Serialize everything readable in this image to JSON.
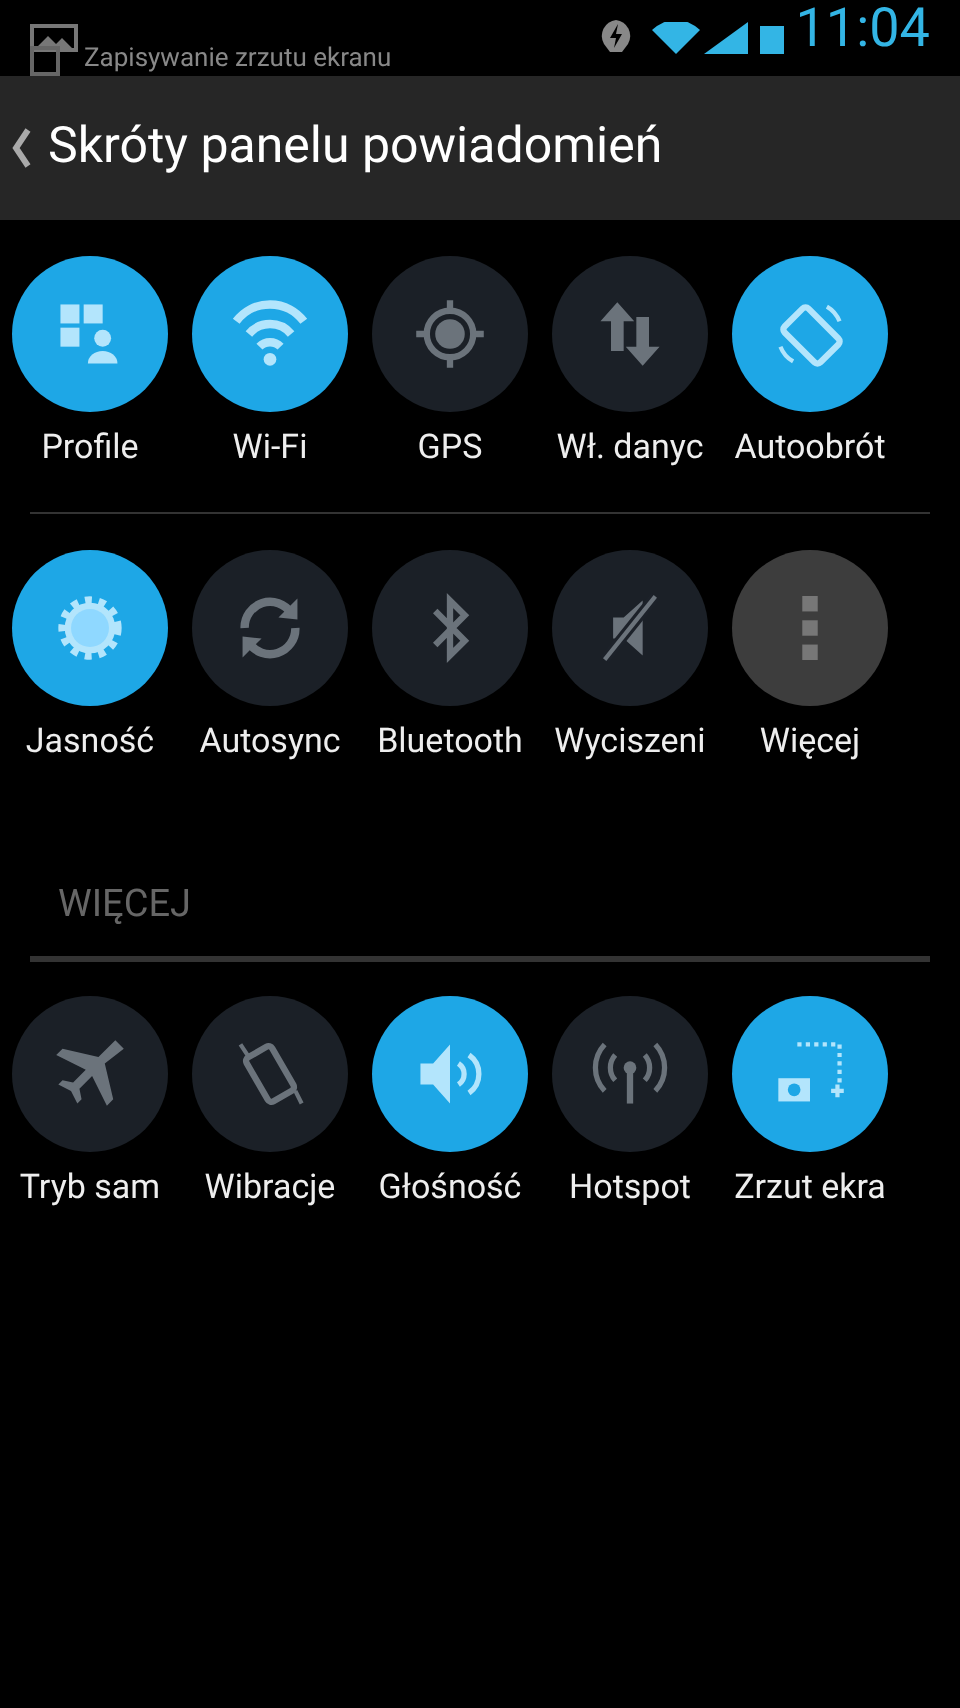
{
  "status_bar": {
    "time": "11:04"
  },
  "notification": {
    "checked": false,
    "title": "Zapisywanie zrzutu ekranu"
  },
  "header": {
    "title": "Skróty panelu powiadomień"
  },
  "groups": [
    {
      "tiles": [
        {
          "label": "Profile",
          "kind": "toggle",
          "on": true
        },
        {
          "label": "Wi-Fi",
          "kind": "toggle",
          "on": true
        },
        {
          "label": "GPS",
          "kind": "toggle",
          "on": false
        },
        {
          "label": "Wł. danyc",
          "kind": "toggle",
          "on": false
        },
        {
          "label": "Autoobrót",
          "kind": "toggle",
          "on": true
        }
      ]
    },
    {
      "tiles": [
        {
          "label": "Jasność",
          "kind": "toggle",
          "on": true
        },
        {
          "label": "Autosync",
          "kind": "toggle",
          "on": false
        },
        {
          "label": "Bluetooth",
          "kind": "toggle",
          "on": false
        },
        {
          "label": "Wyciszeni",
          "kind": "toggle",
          "on": false
        },
        {
          "label": "Więcej",
          "kind": "more"
        }
      ]
    },
    {
      "title": "WIĘCEJ",
      "tiles": [
        {
          "label": "Tryb sam",
          "kind": "toggle",
          "on": false
        },
        {
          "label": "Wibracje",
          "kind": "toggle",
          "on": false
        },
        {
          "label": "Głośność",
          "kind": "toggle",
          "on": true
        },
        {
          "label": "Hotspot",
          "kind": "toggle",
          "on": false
        },
        {
          "label": "Zrzut ekra",
          "kind": "toggle",
          "on": true
        }
      ]
    }
  ]
}
